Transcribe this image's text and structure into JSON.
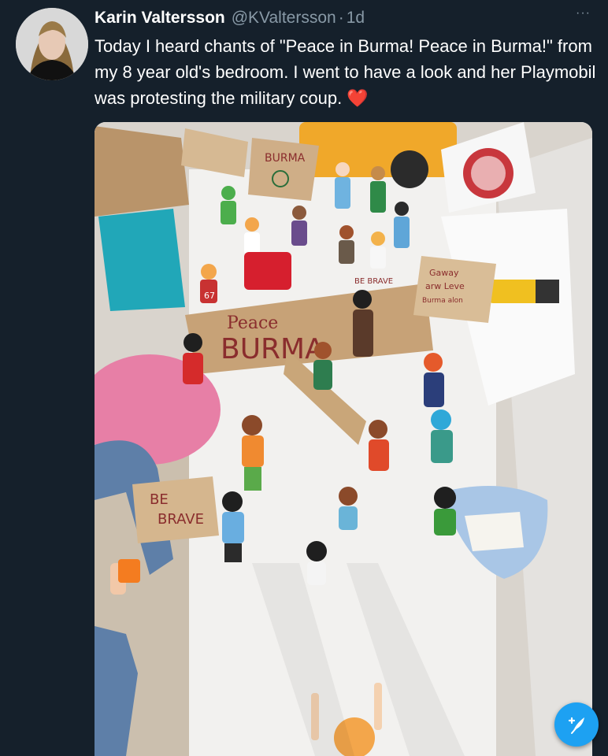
{
  "tweet": {
    "author": {
      "display_name": "Karin Valtersson",
      "handle": "@KValtersson",
      "separator": "·",
      "timestamp": "1d"
    },
    "more_label": "···",
    "text": "Today I heard chants of \"Peace in Burma! Peace in Burma!\" from my 8 year old's bedroom. I went to have a look and her Playmobil was protesting the military coup.",
    "emoji": "❤️"
  },
  "photo": {
    "signs": {
      "burma": "BURMA",
      "peace": "Peace",
      "peace_burma": "BURMA",
      "be_brave_top": "BE BRAVE",
      "be": "BE",
      "brave": "BRAVE",
      "side_sign_line1": "Gaway",
      "side_sign_line2": "arw  Leve",
      "side_sign_line3": "Burma  alon",
      "jersey_number": "67"
    }
  },
  "compose_fab": {
    "icon": "feather-plus-icon"
  },
  "colors": {
    "background": "#15202b",
    "secondary_text": "#8899a6",
    "accent": "#1da1f2",
    "heart": "#e0245e"
  }
}
